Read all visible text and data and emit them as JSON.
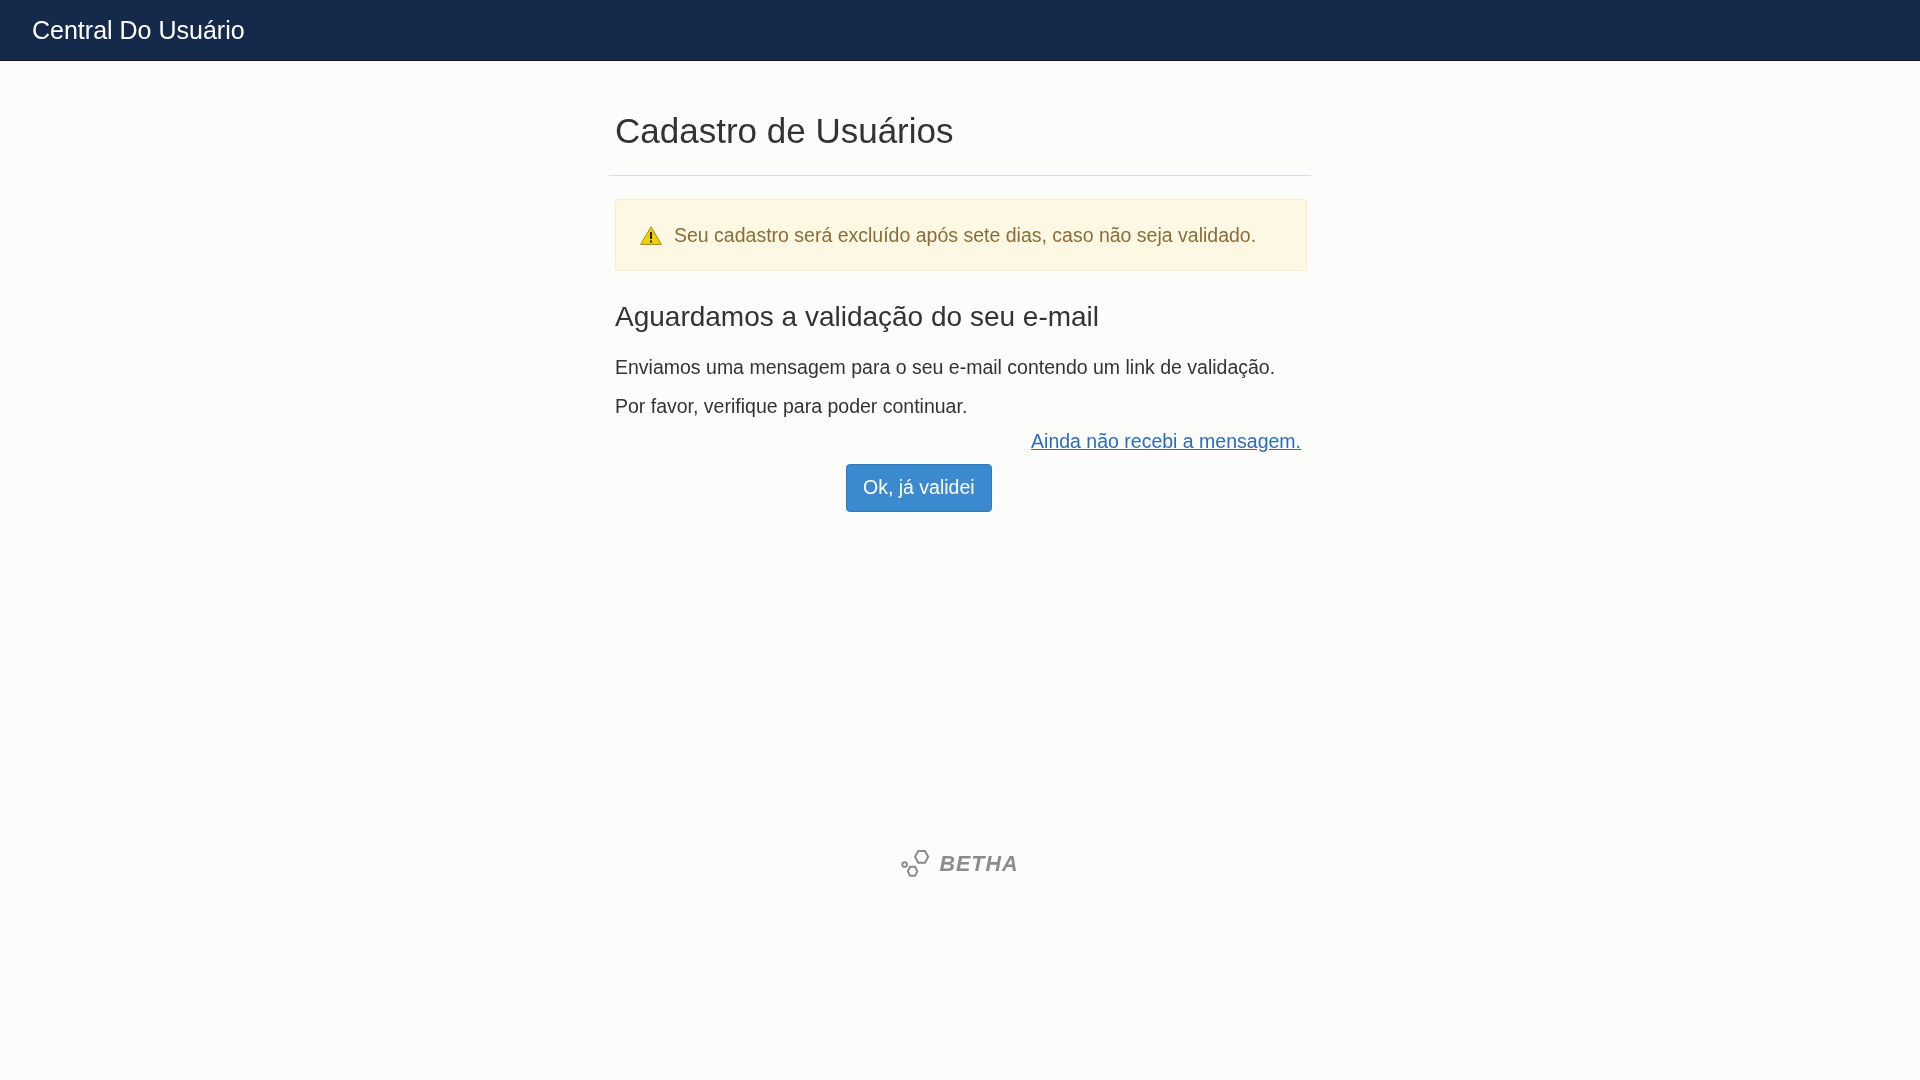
{
  "header": {
    "title": "Central Do Usuário"
  },
  "page": {
    "title": "Cadastro de Usuários"
  },
  "alert": {
    "kind": "warning",
    "text": "Seu cadastro será excluído após sete dias, caso não seja validado."
  },
  "section": {
    "title": "Aguardamos a validação do seu e-mail",
    "paragraphs": [
      "Enviamos uma mensagem para o seu e-mail contendo um link de validação.",
      "Por favor, verifique para poder continuar."
    ],
    "link": "Ainda não recebi a mensagem.",
    "button": "Ok, já validei"
  },
  "footer": {
    "logo_text": "BETHA"
  }
}
